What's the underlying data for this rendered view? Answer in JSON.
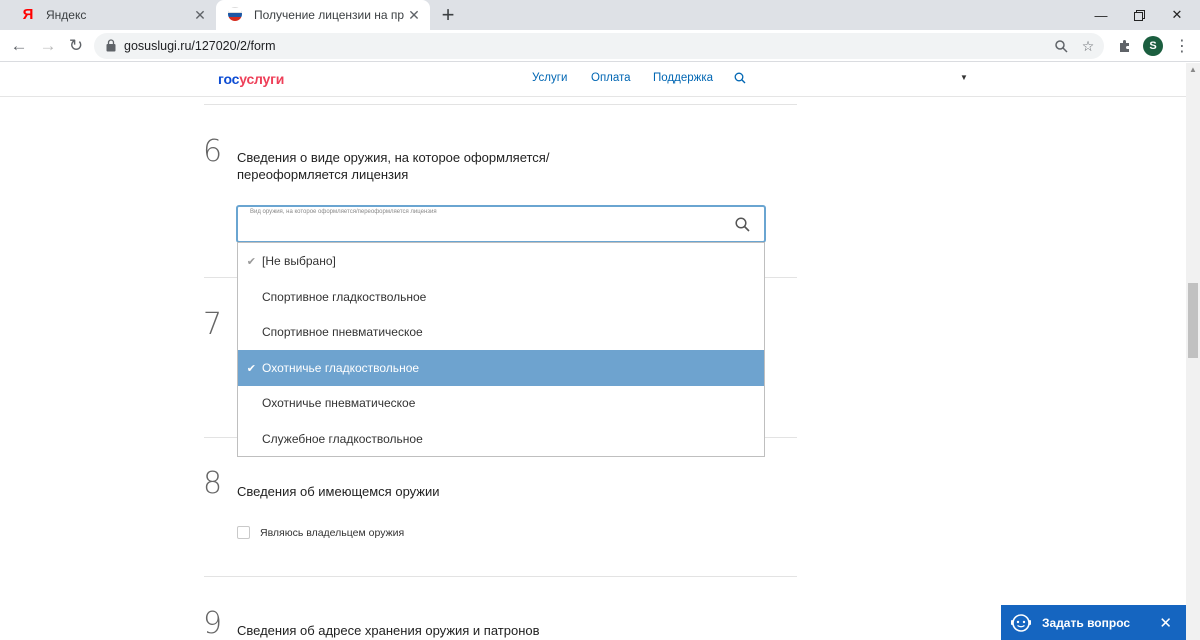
{
  "browser": {
    "tabs": [
      {
        "title": "Яндекс",
        "favicon": "yandex-icon"
      },
      {
        "title": "Получение лицензии на приоб",
        "favicon": "russia-flag-icon",
        "active": true
      }
    ],
    "url": "gosuslugi.ru/127020/2/form",
    "profile_initial": "S",
    "new_tab_symbol": "+",
    "close_symbol": "✕"
  },
  "site": {
    "logo_part1": "гос",
    "logo_part2": "услуги",
    "nav": [
      "Услуги",
      "Оплата",
      "Поддержка"
    ]
  },
  "form": {
    "step6": {
      "number": "6",
      "title_line1": "Сведения о виде оружия, на которое оформляется/",
      "title_line2": "переоформляется лицензия",
      "field_placeholder": "Вид оружия, на которое оформляется/переоформляется лицензия",
      "options": [
        {
          "label": "[Не выбрано]",
          "checked": true,
          "highlighted": false
        },
        {
          "label": "Спортивное гладкоствольное",
          "checked": false,
          "highlighted": false
        },
        {
          "label": "Спортивное пневматическое",
          "checked": false,
          "highlighted": false
        },
        {
          "label": "Охотничье гладкоствольное",
          "checked": true,
          "highlighted": true
        },
        {
          "label": "Охотничье пневматическое",
          "checked": false,
          "highlighted": false
        },
        {
          "label": "Служебное гладкоствольное",
          "checked": false,
          "highlighted": false
        }
      ]
    },
    "step7": {
      "number": "7"
    },
    "step8": {
      "number": "8",
      "title": "Сведения об имеющемся оружии",
      "checkbox_label": "Являюсь владельцем оружия",
      "checkbox_checked": false
    },
    "step9": {
      "number": "9",
      "title": "Сведения об адресе хранения оружия и патронов"
    }
  },
  "chat_widget": {
    "label": "Задать вопрос",
    "close_symbol": "✕"
  },
  "colors": {
    "highlight": "#6ea3cf",
    "focus_border": "#6aa5d1",
    "link": "#0066b3",
    "chat_bg": "#1565c0",
    "logo_blue": "#0d4cd3",
    "logo_red": "#ee3f58"
  }
}
